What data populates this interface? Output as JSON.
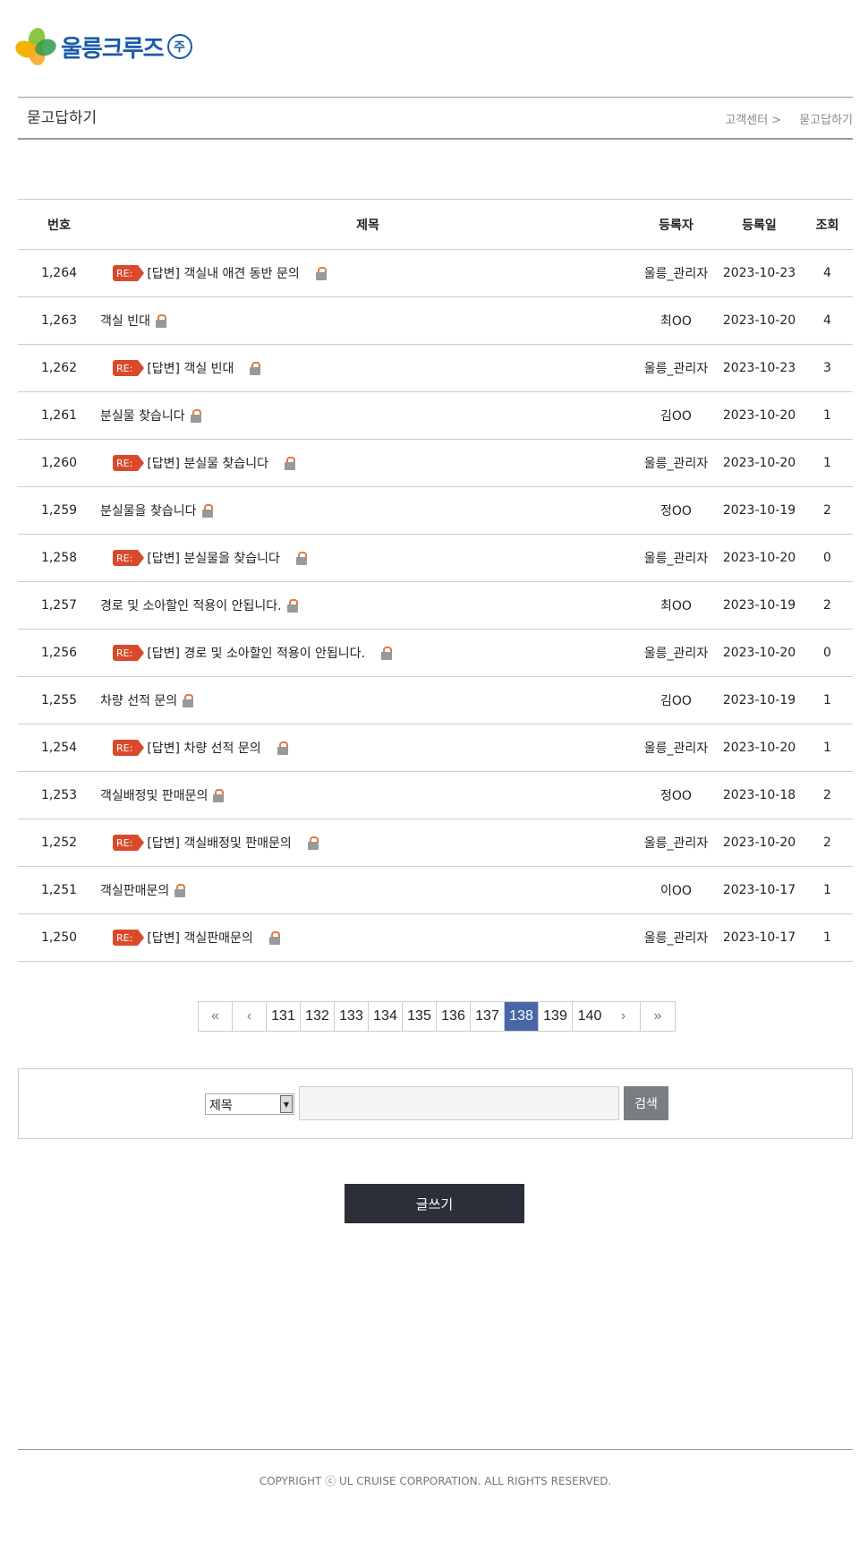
{
  "logo": {
    "name": "울릉크루즈",
    "suffix": "주"
  },
  "header": {
    "title": "묻고답하기",
    "breadcrumb": [
      "고객센터 >",
      "묻고답하기"
    ]
  },
  "table": {
    "columns": [
      "번호",
      "제목",
      "등록자",
      "등록일",
      "조회"
    ],
    "rows": [
      {
        "num": "1,264",
        "reply": true,
        "title": "[답변] 객실내 애견 동반 문의",
        "author": "울릉_관리자",
        "date": "2023-10-23",
        "views": "4"
      },
      {
        "num": "1,263",
        "reply": false,
        "title": "객실 빈대",
        "author": "최OO",
        "date": "2023-10-20",
        "views": "4"
      },
      {
        "num": "1,262",
        "reply": true,
        "title": "[답변] 객실 빈대",
        "author": "울릉_관리자",
        "date": "2023-10-23",
        "views": "3"
      },
      {
        "num": "1,261",
        "reply": false,
        "title": "분실물 찾습니다",
        "author": "김OO",
        "date": "2023-10-20",
        "views": "1"
      },
      {
        "num": "1,260",
        "reply": true,
        "title": "[답변] 분실물 찾습니다",
        "author": "울릉_관리자",
        "date": "2023-10-20",
        "views": "1"
      },
      {
        "num": "1,259",
        "reply": false,
        "title": "분실물을 찾습니다",
        "author": "정OO",
        "date": "2023-10-19",
        "views": "2"
      },
      {
        "num": "1,258",
        "reply": true,
        "title": "[답변] 분실물을 찾습니다",
        "author": "울릉_관리자",
        "date": "2023-10-20",
        "views": "0"
      },
      {
        "num": "1,257",
        "reply": false,
        "title": "경로 및 소아할인 적용이 안됩니다.",
        "author": "최OO",
        "date": "2023-10-19",
        "views": "2"
      },
      {
        "num": "1,256",
        "reply": true,
        "title": "[답변] 경로 및 소아할인 적용이 안됩니다.",
        "author": "울릉_관리자",
        "date": "2023-10-20",
        "views": "0"
      },
      {
        "num": "1,255",
        "reply": false,
        "title": "차량 선적 문의",
        "author": "김OO",
        "date": "2023-10-19",
        "views": "1"
      },
      {
        "num": "1,254",
        "reply": true,
        "title": "[답변] 차량 선적 문의",
        "author": "울릉_관리자",
        "date": "2023-10-20",
        "views": "1"
      },
      {
        "num": "1,253",
        "reply": false,
        "title": "객실배정및 판매문의",
        "author": "정OO",
        "date": "2023-10-18",
        "views": "2"
      },
      {
        "num": "1,252",
        "reply": true,
        "title": "[답변] 객실배정및 판매문의",
        "author": "울릉_관리자",
        "date": "2023-10-20",
        "views": "2"
      },
      {
        "num": "1,251",
        "reply": false,
        "title": "객실판매문의",
        "author": "이OO",
        "date": "2023-10-17",
        "views": "1"
      },
      {
        "num": "1,250",
        "reply": true,
        "title": "[답변] 객실판매문의",
        "author": "울릉_관리자",
        "date": "2023-10-17",
        "views": "1"
      }
    ],
    "reply_badge": "RE:"
  },
  "pagination": {
    "first": "«",
    "prev": "‹",
    "next": "›",
    "last": "»",
    "pages": [
      "131",
      "132",
      "133",
      "134",
      "135",
      "136",
      "137",
      "138",
      "139",
      "140"
    ],
    "current": "138",
    "active_color": "#4766a8"
  },
  "search": {
    "field_selected": "제목",
    "query": "",
    "button": "검색"
  },
  "write_button": "글쓰기",
  "footer": {
    "copyright": "COPYRIGHT ⓒ UL CRUISE CORPORATION. ALL RIGHTS RESERVED."
  },
  "colors": {
    "re_badge": "#d94a2b",
    "logo": "#1a5aa8",
    "write_button": "#2d2f38"
  }
}
